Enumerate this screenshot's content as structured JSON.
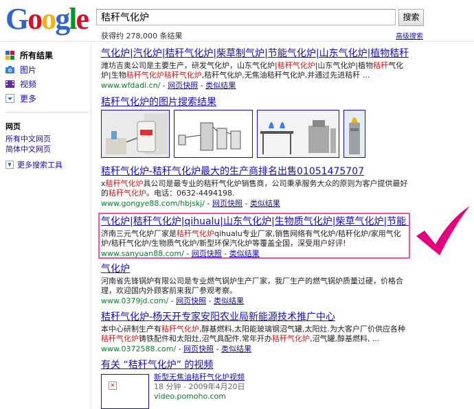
{
  "logo": {
    "letters": [
      "G",
      "o",
      "o",
      "g",
      "l",
      "e"
    ]
  },
  "search": {
    "query": "秸秆气化炉",
    "button": "搜索",
    "stats": "获得约 278,000 条结果",
    "advanced": "高级搜索"
  },
  "sidebar": {
    "items": [
      {
        "label": "所有结果",
        "icon": "all-results-icon"
      },
      {
        "label": "图片",
        "icon": "camera-icon"
      },
      {
        "label": "视频",
        "icon": "film-icon"
      },
      {
        "label": "更多",
        "icon": "chevron-down-icon"
      }
    ],
    "section_title": "网页",
    "links": [
      "所有中文网页",
      "简体中文网页"
    ],
    "more_tools": "更多搜索工具"
  },
  "results": {
    "r1": {
      "title": "气化炉|汽化炉|秸秆气化炉|柴草制气炉|节能气化炉|山东气化炉|植物秸秆 ...",
      "snippet_a": "潍坊吉奥公司是主要生产，研发气化炉，山东气化炉|",
      "snippet_b": "秸秆气化炉",
      "snippet_c": "|山东气化炉|植物",
      "snippet_d": "秸秆",
      "snippet_e": "气化炉|生物",
      "snippet_f": "秸秆气化炉秸秆气化炉",
      "snippet_g": ",秸秆气化炉,无焦油秸秆气化炉,并通过先进秸秆 ...",
      "url": "www.wfdadi.cn/",
      "cache": "网页快照",
      "similar": "类似结果"
    },
    "images": {
      "title": "秸秆气化炉的图片搜索结果"
    },
    "r2": {
      "title": "秸秆气化炉-秸秆气化炉最大的生产商排名出售01051475707",
      "snippet_a": "x",
      "snippet_b": "秸秆气化炉",
      "snippet_c": "具公司是最专业的秸秆气化炉销售商，公司秉承服务大众的原则为客户提供最好的",
      "snippet_d": "秸秆气化炉",
      "snippet_e": "。电话：0632-4494198.",
      "url": "www.gongye88.com/hbjskj/",
      "cache": "网页快照",
      "similar": "类似结果"
    },
    "r3": {
      "title": "气化炉|秸秆气化炉|qihualu|山东气化炉|生物质气化炉|柴草气化炉|节能 ...",
      "snippet_a": "济南三元气化炉厂家是",
      "snippet_b": "秸秆气化炉",
      "snippet_c": "qihualu专业厂家,销售网络有气化炉/秸秆化炉/家用气化炉/秸秆气化炉/生物质气化炉/新型环保汽化炉等覆盖全国，深受用户好评!",
      "url": "www.sanyuan88.com/",
      "cache": "网页快照",
      "similar": "类似结果"
    },
    "r4": {
      "title": "气化炉",
      "snippet": "河南省先锋锅炉有限公司是专业燃气锅炉生产厂家，我厂生产的燃气锅炉质量过硬，价格合理，欢迎国内外顾客前来我厂参观考察。",
      "url": "www.0379jd.com/",
      "cache": "网页快照",
      "similar": "类似结果"
    },
    "r5": {
      "title": "秸秆气化炉-杨天开专家安阳农业局新能源技术推广中心",
      "snippet_a": "本中心研制生产有",
      "snippet_b": "秸秆气化炉",
      "snippet_c": ",醇基燃料,太阳能玻璃钢沼气罐,太阳灶.为大客户厂价供应各种",
      "snippet_d": "秸秆气化炉",
      "snippet_e": "铸铁配件和太阳灶,沼气具配件.常年开办",
      "snippet_f": "秸秆气化炉",
      "snippet_g": ",沼气罐,醇基燃料, ...",
      "url": "www.0372588.com/",
      "cache": "网页快照",
      "similar": "类似结果"
    },
    "videos": {
      "title": "有关 “秸秆气化炉” 的视频",
      "item_title": "新型无焦油秸秆气化炉视频",
      "meta": "18 分钟 - 2009年4月20日",
      "source": "video.pomoho.com"
    }
  },
  "colors": {
    "link": "#1a0dab",
    "url": "#0a7d2c",
    "keyword": "#c81c1c",
    "checkmark": "#e6007e",
    "highlight_box": "#e85aa0"
  }
}
